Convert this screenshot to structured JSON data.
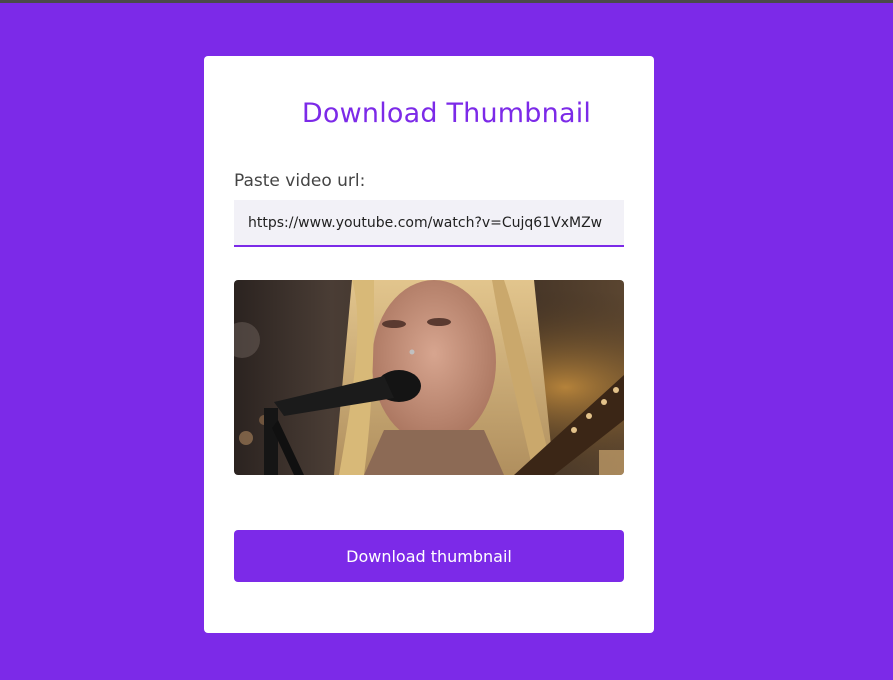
{
  "page": {
    "title": "Download Thumbnail"
  },
  "form": {
    "label": "Paste video url:",
    "url_value": "https://www.youtube.com/watch?v=Cujq61VxMZw"
  },
  "thumbnail": {
    "alt": "Video thumbnail preview"
  },
  "actions": {
    "download_label": "Download thumbnail"
  },
  "colors": {
    "accent": "#7c2ae8",
    "card_bg": "#ffffff",
    "input_bg": "#f2f1f7"
  }
}
